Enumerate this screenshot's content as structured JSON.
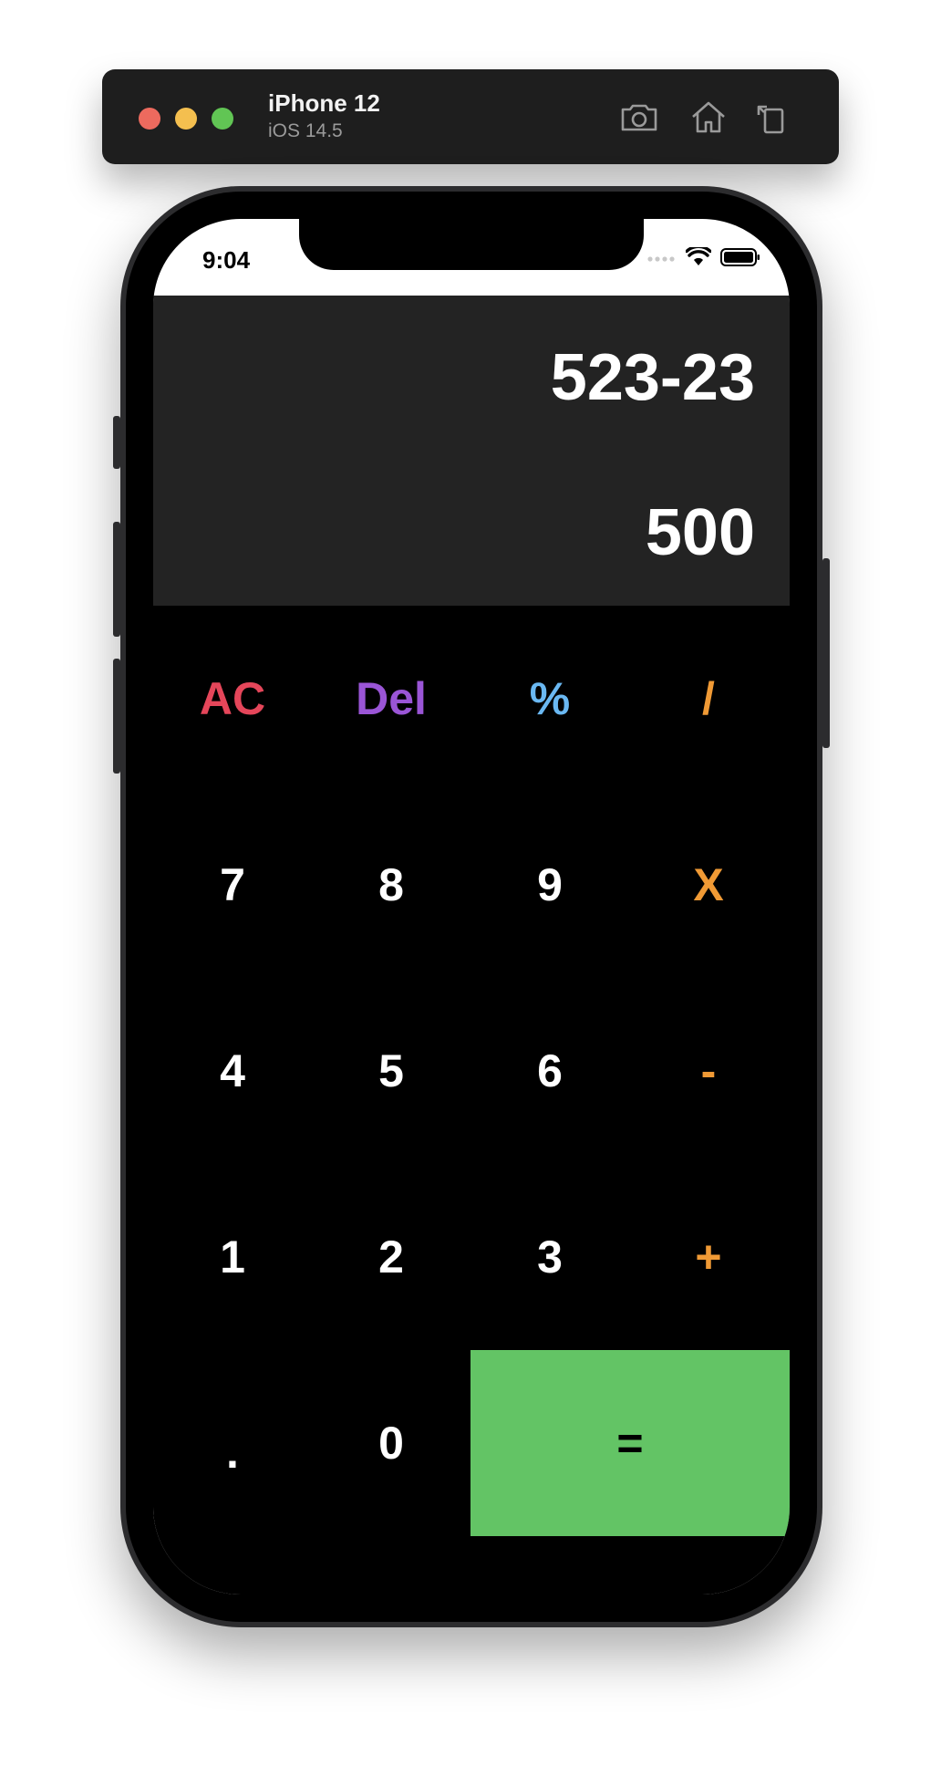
{
  "simulator": {
    "device_name": "iPhone 12",
    "os_version": "iOS 14.5",
    "toolbar_icons": [
      "screenshot-icon",
      "home-icon",
      "rotate-icon"
    ]
  },
  "status_bar": {
    "time": "9:04",
    "icons": [
      "cellular-icon",
      "wifi-icon",
      "battery-icon"
    ]
  },
  "display": {
    "expression": "523-23",
    "result": "500"
  },
  "keypad": {
    "rows": [
      [
        {
          "label": "AC",
          "color": "#e5465a"
        },
        {
          "label": "Del",
          "color": "#9a55d6"
        },
        {
          "label": "%",
          "color": "#6ab8f2"
        },
        {
          "label": "/",
          "color": "#f09a35"
        }
      ],
      [
        {
          "label": "7",
          "color": "#ffffff"
        },
        {
          "label": "8",
          "color": "#ffffff"
        },
        {
          "label": "9",
          "color": "#ffffff"
        },
        {
          "label": "X",
          "color": "#f09a35"
        }
      ],
      [
        {
          "label": "4",
          "color": "#ffffff"
        },
        {
          "label": "5",
          "color": "#ffffff"
        },
        {
          "label": "6",
          "color": "#ffffff"
        },
        {
          "label": "-",
          "color": "#f09a35"
        }
      ],
      [
        {
          "label": "1",
          "color": "#ffffff"
        },
        {
          "label": "2",
          "color": "#ffffff"
        },
        {
          "label": "3",
          "color": "#ffffff"
        },
        {
          "label": "+",
          "color": "#f09a35"
        }
      ],
      [
        {
          "label": ".",
          "color": "#ffffff"
        },
        {
          "label": "0",
          "color": "#ffffff"
        },
        {
          "label": "=",
          "color": "#000000",
          "background": "#63c465"
        }
      ]
    ]
  },
  "colors": {
    "display_background": "#232323",
    "keypad_background": "#000000",
    "equals_background": "#63c465",
    "operator": "#f09a35",
    "clear": "#e5465a",
    "delete": "#9a55d6",
    "percent": "#6ab8f2"
  }
}
